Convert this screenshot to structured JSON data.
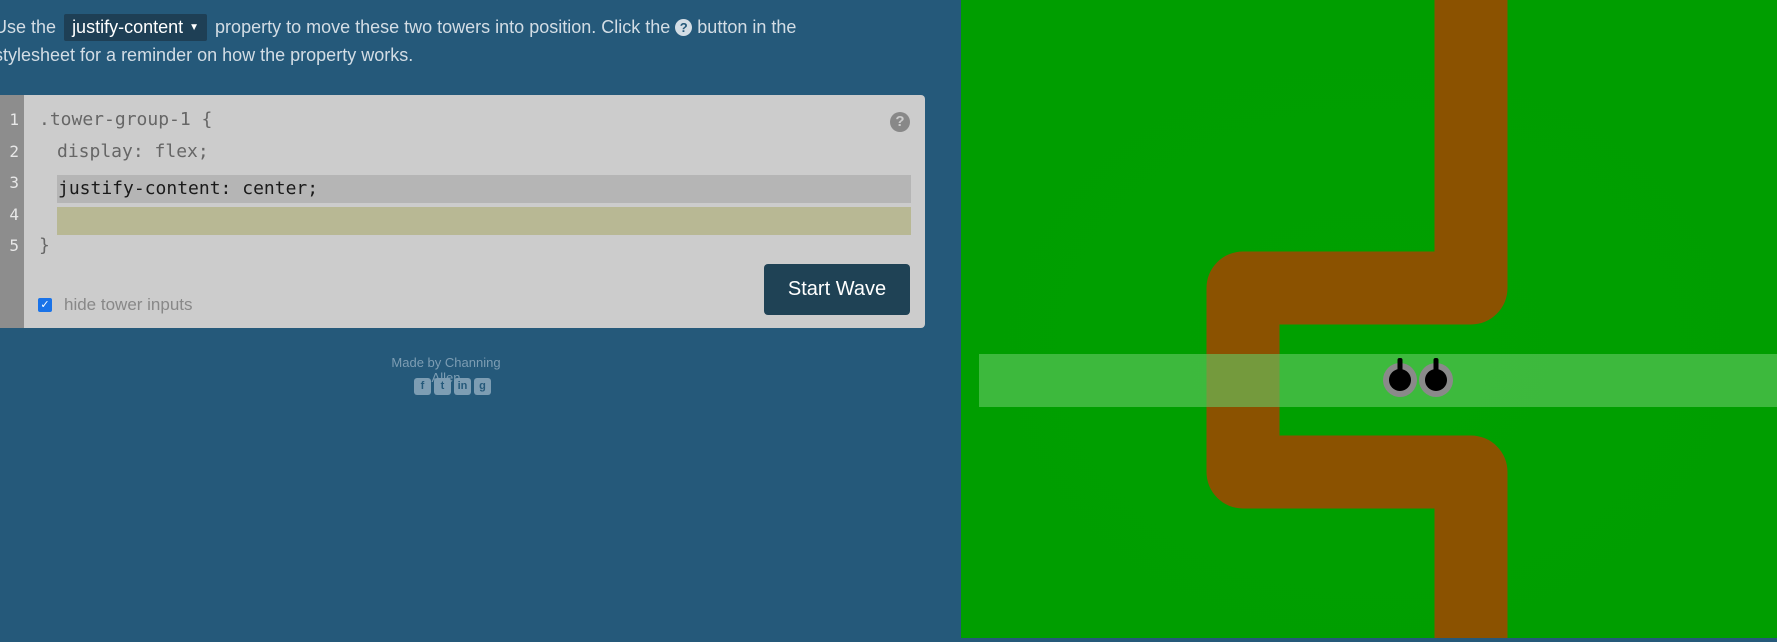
{
  "instructions": {
    "prefix": "Use the",
    "property_select": "justify-content",
    "middle": "property to move these two towers into position. Click the",
    "suffix": "button in the",
    "line2": "stylesheet for a reminder on how the property works."
  },
  "editor": {
    "line_numbers": [
      "1",
      "2",
      "3",
      "4",
      "5"
    ],
    "line1": ".tower-group-1 {",
    "line2": "display: flex;",
    "input_filled": "justify-content: center;",
    "input_empty": "",
    "line5": "}",
    "help_label": "?",
    "checkbox_label": "hide tower inputs",
    "checkbox_checked": true,
    "start_button": "Start Wave"
  },
  "footer": {
    "credit": "Made by Channing Allen",
    "social_icons": [
      "facebook-icon",
      "twitter-icon",
      "linkedin-icon",
      "github-icon"
    ]
  },
  "game": {
    "grass_color": "#00a000",
    "path_color": "#8b5200",
    "tower_group_color": "#66cc66",
    "tower_count": 2
  }
}
